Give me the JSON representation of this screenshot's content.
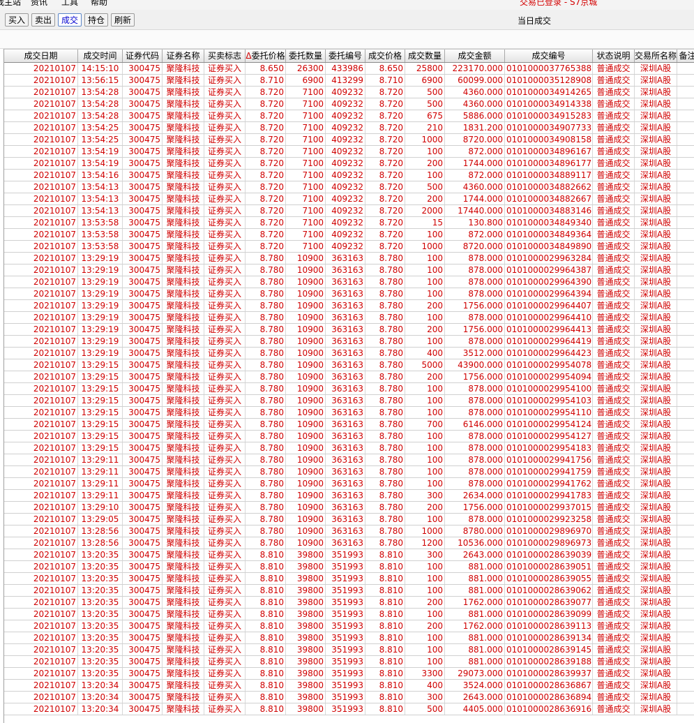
{
  "menu": {
    "items": [
      "我主站",
      "资讯",
      "工具",
      "帮助"
    ],
    "login_status": "交易已登录 - S7京城"
  },
  "toolbar": {
    "buttons": [
      "买入",
      "卖出",
      "成交",
      "持仓",
      "刷新"
    ],
    "active": "成交",
    "title": "当日成交"
  },
  "colors": {
    "text_red": "#d00000",
    "active_blue": "#0000d0"
  },
  "table": {
    "columns": [
      "成交日期",
      "成交时间",
      "证券代码",
      "证券名称",
      "买卖标志",
      "委托价格",
      "委托数量",
      "委托编号",
      "成交价格",
      "成交数量",
      "成交金额",
      "成交编号",
      "状态说明",
      "交易所名称",
      "备注"
    ],
    "sort_marker": "Δ",
    "sorted_column": "委托价格",
    "row_defaults": {
      "date": "20210107",
      "code": "300475",
      "name": "聚隆科技",
      "side": "证券买入",
      "status": "普通成交",
      "exchange": "深圳A股"
    },
    "rows": [
      [
        "20210107",
        "14:15:10",
        "300475",
        "聚隆科技",
        "证券买入",
        "8.650",
        "26300",
        "433986",
        "8.650",
        "25800",
        "223170.000",
        "0101000037765388",
        "普通成交",
        "深圳A股"
      ],
      [
        "20210107",
        "13:56:15",
        "300475",
        "聚隆科技",
        "证券买入",
        "8.710",
        "6900",
        "413299",
        "8.710",
        "6900",
        "60099.000",
        "0101000035128908",
        "普通成交",
        "深圳A股"
      ],
      [
        "20210107",
        "13:54:28",
        "300475",
        "聚隆科技",
        "证券买入",
        "8.720",
        "7100",
        "409232",
        "8.720",
        "500",
        "4360.000",
        "0101000034914265",
        "普通成交",
        "深圳A股"
      ],
      [
        "20210107",
        "13:54:28",
        "300475",
        "聚隆科技",
        "证券买入",
        "8.720",
        "7100",
        "409232",
        "8.720",
        "500",
        "4360.000",
        "0101000034914338",
        "普通成交",
        "深圳A股"
      ],
      [
        "20210107",
        "13:54:28",
        "300475",
        "聚隆科技",
        "证券买入",
        "8.720",
        "7100",
        "409232",
        "8.720",
        "675",
        "5886.000",
        "0101000034915283",
        "普通成交",
        "深圳A股"
      ],
      [
        "20210107",
        "13:54:25",
        "300475",
        "聚隆科技",
        "证券买入",
        "8.720",
        "7100",
        "409232",
        "8.720",
        "210",
        "1831.200",
        "0101000034907733",
        "普通成交",
        "深圳A股"
      ],
      [
        "20210107",
        "13:54:25",
        "300475",
        "聚隆科技",
        "证券买入",
        "8.720",
        "7100",
        "409232",
        "8.720",
        "1000",
        "8720.000",
        "0101000034908158",
        "普通成交",
        "深圳A股"
      ],
      [
        "20210107",
        "13:54:19",
        "300475",
        "聚隆科技",
        "证券买入",
        "8.720",
        "7100",
        "409232",
        "8.720",
        "100",
        "872.000",
        "0101000034896167",
        "普通成交",
        "深圳A股"
      ],
      [
        "20210107",
        "13:54:19",
        "300475",
        "聚隆科技",
        "证券买入",
        "8.720",
        "7100",
        "409232",
        "8.720",
        "200",
        "1744.000",
        "0101000034896177",
        "普通成交",
        "深圳A股"
      ],
      [
        "20210107",
        "13:54:16",
        "300475",
        "聚隆科技",
        "证券买入",
        "8.720",
        "7100",
        "409232",
        "8.720",
        "100",
        "872.000",
        "0101000034889117",
        "普通成交",
        "深圳A股"
      ],
      [
        "20210107",
        "13:54:13",
        "300475",
        "聚隆科技",
        "证券买入",
        "8.720",
        "7100",
        "409232",
        "8.720",
        "500",
        "4360.000",
        "0101000034882662",
        "普通成交",
        "深圳A股"
      ],
      [
        "20210107",
        "13:54:13",
        "300475",
        "聚隆科技",
        "证券买入",
        "8.720",
        "7100",
        "409232",
        "8.720",
        "200",
        "1744.000",
        "0101000034882667",
        "普通成交",
        "深圳A股"
      ],
      [
        "20210107",
        "13:54:13",
        "300475",
        "聚隆科技",
        "证券买入",
        "8.720",
        "7100",
        "409232",
        "8.720",
        "2000",
        "17440.000",
        "0101000034883146",
        "普通成交",
        "深圳A股"
      ],
      [
        "20210107",
        "13:53:58",
        "300475",
        "聚隆科技",
        "证券买入",
        "8.720",
        "7100",
        "409232",
        "8.720",
        "15",
        "130.800",
        "0101000034849340",
        "普通成交",
        "深圳A股"
      ],
      [
        "20210107",
        "13:53:58",
        "300475",
        "聚隆科技",
        "证券买入",
        "8.720",
        "7100",
        "409232",
        "8.720",
        "100",
        "872.000",
        "0101000034849364",
        "普通成交",
        "深圳A股"
      ],
      [
        "20210107",
        "13:53:58",
        "300475",
        "聚隆科技",
        "证券买入",
        "8.720",
        "7100",
        "409232",
        "8.720",
        "1000",
        "8720.000",
        "0101000034849890",
        "普通成交",
        "深圳A股"
      ],
      [
        "20210107",
        "13:29:19",
        "300475",
        "聚隆科技",
        "证券买入",
        "8.780",
        "10900",
        "363163",
        "8.780",
        "100",
        "878.000",
        "0101000029963284",
        "普通成交",
        "深圳A股"
      ],
      [
        "20210107",
        "13:29:19",
        "300475",
        "聚隆科技",
        "证券买入",
        "8.780",
        "10900",
        "363163",
        "8.780",
        "100",
        "878.000",
        "0101000029964387",
        "普通成交",
        "深圳A股"
      ],
      [
        "20210107",
        "13:29:19",
        "300475",
        "聚隆科技",
        "证券买入",
        "8.780",
        "10900",
        "363163",
        "8.780",
        "100",
        "878.000",
        "0101000029964390",
        "普通成交",
        "深圳A股"
      ],
      [
        "20210107",
        "13:29:19",
        "300475",
        "聚隆科技",
        "证券买入",
        "8.780",
        "10900",
        "363163",
        "8.780",
        "100",
        "878.000",
        "0101000029964394",
        "普通成交",
        "深圳A股"
      ],
      [
        "20210107",
        "13:29:19",
        "300475",
        "聚隆科技",
        "证券买入",
        "8.780",
        "10900",
        "363163",
        "8.780",
        "200",
        "1756.000",
        "0101000029964407",
        "普通成交",
        "深圳A股"
      ],
      [
        "20210107",
        "13:29:19",
        "300475",
        "聚隆科技",
        "证券买入",
        "8.780",
        "10900",
        "363163",
        "8.780",
        "100",
        "878.000",
        "0101000029964410",
        "普通成交",
        "深圳A股"
      ],
      [
        "20210107",
        "13:29:19",
        "300475",
        "聚隆科技",
        "证券买入",
        "8.780",
        "10900",
        "363163",
        "8.780",
        "200",
        "1756.000",
        "0101000029964413",
        "普通成交",
        "深圳A股"
      ],
      [
        "20210107",
        "13:29:19",
        "300475",
        "聚隆科技",
        "证券买入",
        "8.780",
        "10900",
        "363163",
        "8.780",
        "100",
        "878.000",
        "0101000029964419",
        "普通成交",
        "深圳A股"
      ],
      [
        "20210107",
        "13:29:19",
        "300475",
        "聚隆科技",
        "证券买入",
        "8.780",
        "10900",
        "363163",
        "8.780",
        "400",
        "3512.000",
        "0101000029964423",
        "普通成交",
        "深圳A股"
      ],
      [
        "20210107",
        "13:29:15",
        "300475",
        "聚隆科技",
        "证券买入",
        "8.780",
        "10900",
        "363163",
        "8.780",
        "5000",
        "43900.000",
        "0101000029954078",
        "普通成交",
        "深圳A股"
      ],
      [
        "20210107",
        "13:29:15",
        "300475",
        "聚隆科技",
        "证券买入",
        "8.780",
        "10900",
        "363163",
        "8.780",
        "200",
        "1756.000",
        "0101000029954094",
        "普通成交",
        "深圳A股"
      ],
      [
        "20210107",
        "13:29:15",
        "300475",
        "聚隆科技",
        "证券买入",
        "8.780",
        "10900",
        "363163",
        "8.780",
        "100",
        "878.000",
        "0101000029954100",
        "普通成交",
        "深圳A股"
      ],
      [
        "20210107",
        "13:29:15",
        "300475",
        "聚隆科技",
        "证券买入",
        "8.780",
        "10900",
        "363163",
        "8.780",
        "100",
        "878.000",
        "0101000029954103",
        "普通成交",
        "深圳A股"
      ],
      [
        "20210107",
        "13:29:15",
        "300475",
        "聚隆科技",
        "证券买入",
        "8.780",
        "10900",
        "363163",
        "8.780",
        "100",
        "878.000",
        "0101000029954110",
        "普通成交",
        "深圳A股"
      ],
      [
        "20210107",
        "13:29:15",
        "300475",
        "聚隆科技",
        "证券买入",
        "8.780",
        "10900",
        "363163",
        "8.780",
        "700",
        "6146.000",
        "0101000029954124",
        "普通成交",
        "深圳A股"
      ],
      [
        "20210107",
        "13:29:15",
        "300475",
        "聚隆科技",
        "证券买入",
        "8.780",
        "10900",
        "363163",
        "8.780",
        "100",
        "878.000",
        "0101000029954127",
        "普通成交",
        "深圳A股"
      ],
      [
        "20210107",
        "13:29:15",
        "300475",
        "聚隆科技",
        "证券买入",
        "8.780",
        "10900",
        "363163",
        "8.780",
        "100",
        "878.000",
        "0101000029954183",
        "普通成交",
        "深圳A股"
      ],
      [
        "20210107",
        "13:29:11",
        "300475",
        "聚隆科技",
        "证券买入",
        "8.780",
        "10900",
        "363163",
        "8.780",
        "100",
        "878.000",
        "0101000029941756",
        "普通成交",
        "深圳A股"
      ],
      [
        "20210107",
        "13:29:11",
        "300475",
        "聚隆科技",
        "证券买入",
        "8.780",
        "10900",
        "363163",
        "8.780",
        "100",
        "878.000",
        "0101000029941759",
        "普通成交",
        "深圳A股"
      ],
      [
        "20210107",
        "13:29:11",
        "300475",
        "聚隆科技",
        "证券买入",
        "8.780",
        "10900",
        "363163",
        "8.780",
        "100",
        "878.000",
        "0101000029941762",
        "普通成交",
        "深圳A股"
      ],
      [
        "20210107",
        "13:29:11",
        "300475",
        "聚隆科技",
        "证券买入",
        "8.780",
        "10900",
        "363163",
        "8.780",
        "300",
        "2634.000",
        "0101000029941783",
        "普通成交",
        "深圳A股"
      ],
      [
        "20210107",
        "13:29:10",
        "300475",
        "聚隆科技",
        "证券买入",
        "8.780",
        "10900",
        "363163",
        "8.780",
        "200",
        "1756.000",
        "0101000029937015",
        "普通成交",
        "深圳A股"
      ],
      [
        "20210107",
        "13:29:05",
        "300475",
        "聚隆科技",
        "证券买入",
        "8.780",
        "10900",
        "363163",
        "8.780",
        "100",
        "878.000",
        "0101000029923258",
        "普通成交",
        "深圳A股"
      ],
      [
        "20210107",
        "13:28:56",
        "300475",
        "聚隆科技",
        "证券买入",
        "8.780",
        "10900",
        "363163",
        "8.780",
        "1000",
        "8780.000",
        "0101000029896970",
        "普通成交",
        "深圳A股"
      ],
      [
        "20210107",
        "13:28:56",
        "300475",
        "聚隆科技",
        "证券买入",
        "8.780",
        "10900",
        "363163",
        "8.780",
        "1200",
        "10536.000",
        "0101000029896973",
        "普通成交",
        "深圳A股"
      ],
      [
        "20210107",
        "13:20:35",
        "300475",
        "聚隆科技",
        "证券买入",
        "8.810",
        "39800",
        "351993",
        "8.810",
        "300",
        "2643.000",
        "0101000028639039",
        "普通成交",
        "深圳A股"
      ],
      [
        "20210107",
        "13:20:35",
        "300475",
        "聚隆科技",
        "证券买入",
        "8.810",
        "39800",
        "351993",
        "8.810",
        "100",
        "881.000",
        "0101000028639051",
        "普通成交",
        "深圳A股"
      ],
      [
        "20210107",
        "13:20:35",
        "300475",
        "聚隆科技",
        "证券买入",
        "8.810",
        "39800",
        "351993",
        "8.810",
        "100",
        "881.000",
        "0101000028639055",
        "普通成交",
        "深圳A股"
      ],
      [
        "20210107",
        "13:20:35",
        "300475",
        "聚隆科技",
        "证券买入",
        "8.810",
        "39800",
        "351993",
        "8.810",
        "100",
        "881.000",
        "0101000028639062",
        "普通成交",
        "深圳A股"
      ],
      [
        "20210107",
        "13:20:35",
        "300475",
        "聚隆科技",
        "证券买入",
        "8.810",
        "39800",
        "351993",
        "8.810",
        "200",
        "1762.000",
        "0101000028639077",
        "普通成交",
        "深圳A股"
      ],
      [
        "20210107",
        "13:20:35",
        "300475",
        "聚隆科技",
        "证券买入",
        "8.810",
        "39800",
        "351993",
        "8.810",
        "100",
        "881.000",
        "0101000028639099",
        "普通成交",
        "深圳A股"
      ],
      [
        "20210107",
        "13:20:35",
        "300475",
        "聚隆科技",
        "证券买入",
        "8.810",
        "39800",
        "351993",
        "8.810",
        "200",
        "1762.000",
        "0101000028639113",
        "普通成交",
        "深圳A股"
      ],
      [
        "20210107",
        "13:20:35",
        "300475",
        "聚隆科技",
        "证券买入",
        "8.810",
        "39800",
        "351993",
        "8.810",
        "100",
        "881.000",
        "0101000028639134",
        "普通成交",
        "深圳A股"
      ],
      [
        "20210107",
        "13:20:35",
        "300475",
        "聚隆科技",
        "证券买入",
        "8.810",
        "39800",
        "351993",
        "8.810",
        "100",
        "881.000",
        "0101000028639145",
        "普通成交",
        "深圳A股"
      ],
      [
        "20210107",
        "13:20:35",
        "300475",
        "聚隆科技",
        "证券买入",
        "8.810",
        "39800",
        "351993",
        "8.810",
        "100",
        "881.000",
        "0101000028639188",
        "普通成交",
        "深圳A股"
      ],
      [
        "20210107",
        "13:20:35",
        "300475",
        "聚隆科技",
        "证券买入",
        "8.810",
        "39800",
        "351993",
        "8.810",
        "3300",
        "29073.000",
        "0101000028639937",
        "普通成交",
        "深圳A股"
      ],
      [
        "20210107",
        "13:20:34",
        "300475",
        "聚隆科技",
        "证券买入",
        "8.810",
        "39800",
        "351993",
        "8.810",
        "400",
        "3524.000",
        "0101000028636867",
        "普通成交",
        "深圳A股"
      ],
      [
        "20210107",
        "13:20:34",
        "300475",
        "聚隆科技",
        "证券买入",
        "8.810",
        "39800",
        "351993",
        "8.810",
        "300",
        "2643.000",
        "0101000028636894",
        "普通成交",
        "深圳A股"
      ],
      [
        "20210107",
        "13:20:34",
        "300475",
        "聚隆科技",
        "证券买入",
        "8.810",
        "39800",
        "351993",
        "8.810",
        "500",
        "4405.000",
        "0101000028636916",
        "普通成交",
        "深圳A股"
      ]
    ]
  }
}
